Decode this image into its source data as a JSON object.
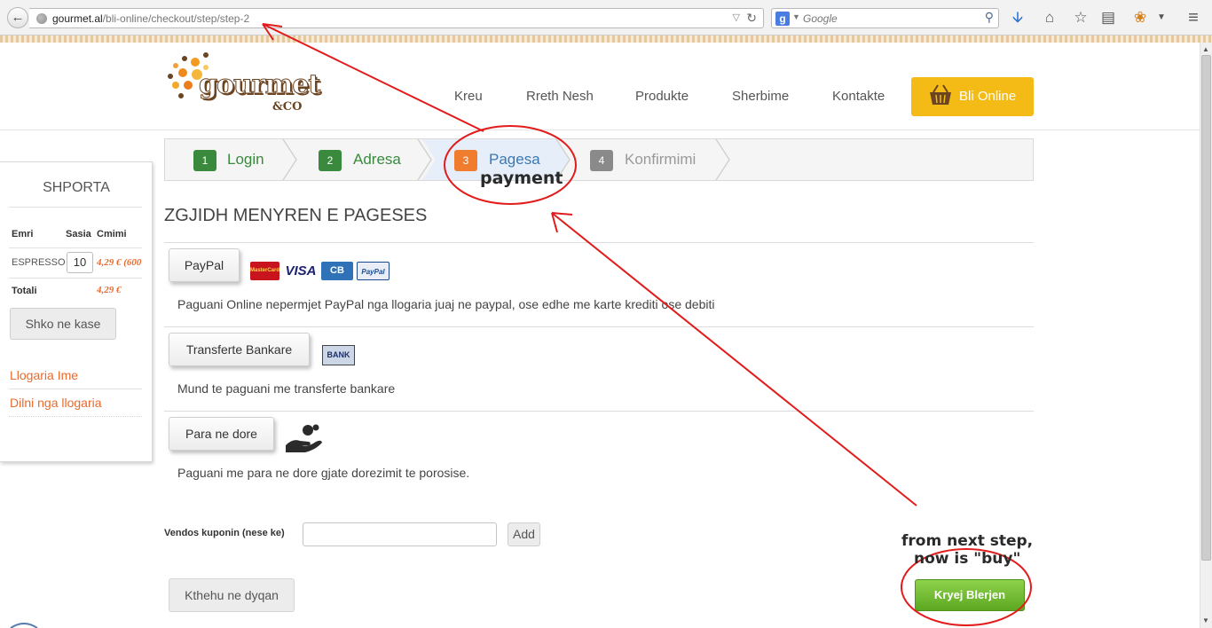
{
  "browser": {
    "url_domain": "gourmet.al",
    "url_path": "/bli-online/checkout/step/step-2",
    "search_engine_letter": "g",
    "search_placeholder": "Google"
  },
  "site": {
    "logo_text": "gourmet",
    "logo_sub": "&CO",
    "nav": [
      "Kreu",
      "Rreth Nesh",
      "Produkte",
      "Sherbime",
      "Kontakte"
    ],
    "cta_label": "Bli Online"
  },
  "cart": {
    "title": "SHPORTA",
    "col_name": "Emri",
    "col_qty": "Sasia",
    "col_price": "Cmimi",
    "item_name": "ESPRESSO",
    "item_qty": "10",
    "item_price": "4,29 € (600",
    "total_label": "Totali",
    "total_value": "4,29 €",
    "checkout_button": "Shko ne kase",
    "link_account": "Llogaria Ime",
    "link_logout": "Dilni nga llogaria"
  },
  "steps": [
    {
      "num": "1",
      "label": "Login",
      "color": "#3a8a3e"
    },
    {
      "num": "2",
      "label": "Adresa",
      "color": "#3a8a3e"
    },
    {
      "num": "3",
      "label": "Pagesa",
      "color": "#f07c2e"
    },
    {
      "num": "4",
      "label": "Konfirmimi",
      "color": "#8a8a8a"
    }
  ],
  "payment": {
    "title": "ZGJIDH MENYREN E PAGESES",
    "paypal_button": "PayPal",
    "paypal_desc": "Paguani Online nepermjet PayPal nga llogaria juaj ne paypal, ose edhe me karte krediti ose debiti",
    "cards": [
      "MasterCard",
      "VISA",
      "CB",
      "PayPal"
    ],
    "bank_button": "Transferte Bankare",
    "bank_icon_text": "BANK",
    "bank_desc": "Mund te paguani me transferte bankare",
    "cash_button": "Para ne dore",
    "cash_desc": "Paguani me para ne dore gjate dorezimit te porosise."
  },
  "coupon": {
    "label": "Vendos kuponin (nese ke)",
    "value": "",
    "add_button": "Add"
  },
  "actions": {
    "back_to_shop": "Kthehu ne dyqan",
    "buy": "Kryej Blerjen"
  },
  "annotations": {
    "payment_note": "payment",
    "next_step_line1": "from next step,",
    "next_step_line2": "now is \"buy\"",
    "arrow_color": "#e21b1b"
  }
}
